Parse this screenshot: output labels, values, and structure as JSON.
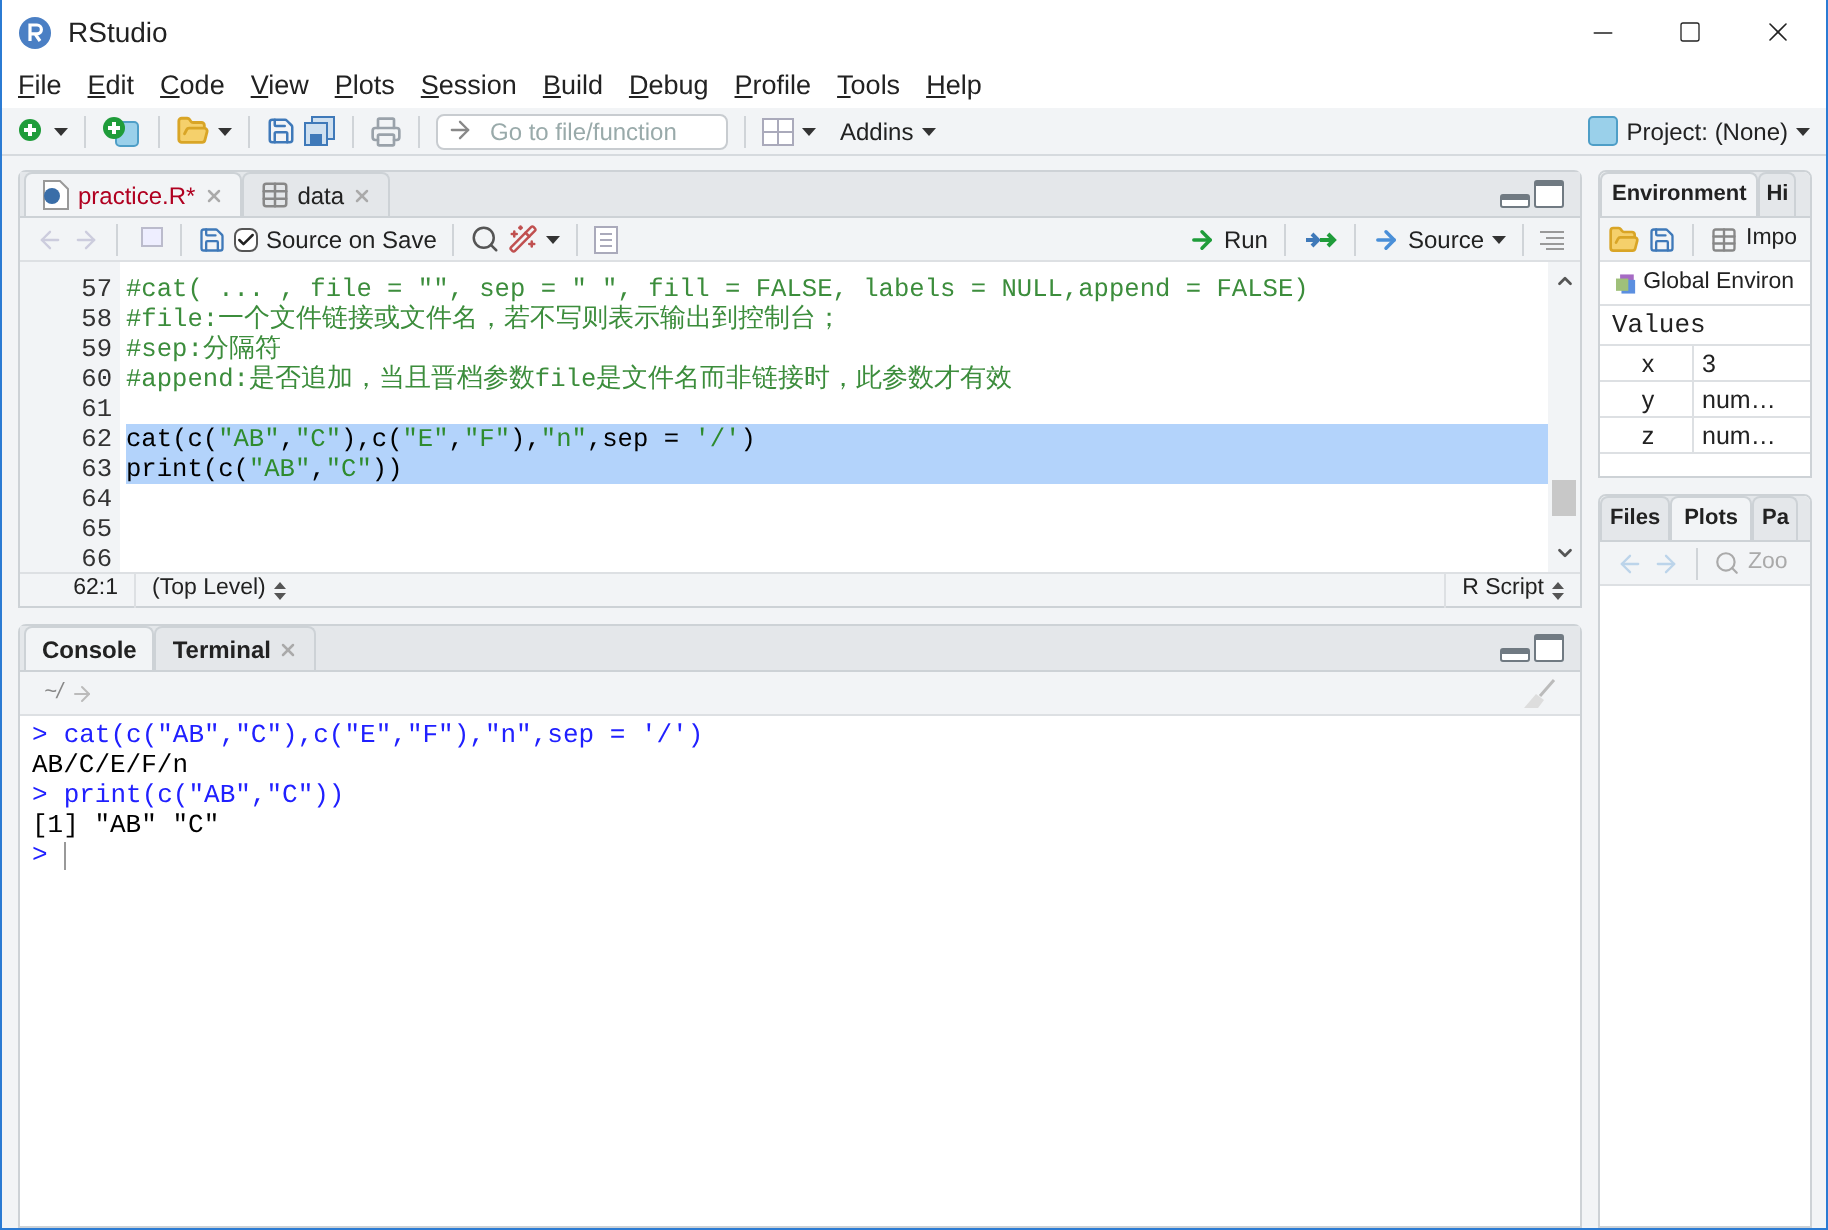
{
  "window": {
    "title": "RStudio"
  },
  "menu": [
    {
      "label": "File"
    },
    {
      "label": "Edit"
    },
    {
      "label": "Code"
    },
    {
      "label": "View"
    },
    {
      "label": "Plots"
    },
    {
      "label": "Session"
    },
    {
      "label": "Build"
    },
    {
      "label": "Debug"
    },
    {
      "label": "Profile"
    },
    {
      "label": "Tools"
    },
    {
      "label": "Help"
    }
  ],
  "toolbar": {
    "go_to_file": {
      "placeholder": "Go to file/function"
    },
    "addins": "Addins",
    "project": "Project: (None)"
  },
  "editor": {
    "tabs": [
      {
        "label": "practice.R*",
        "kind": "script",
        "selected": true,
        "modified": true
      },
      {
        "label": "data",
        "kind": "data",
        "selected": false,
        "modified": false
      }
    ],
    "source_on_save": {
      "label": "Source on Save",
      "checked": true
    },
    "run": "Run",
    "source": "Source",
    "lines": [
      {
        "number": "57",
        "selected": false,
        "tokens": [
          {
            "text": "#cat( ... , file = \"\", sep = \" \", fill = FALSE, labels = NULL,append = FALSE)",
            "kind": "comment"
          }
        ]
      },
      {
        "number": "58",
        "selected": false,
        "tokens": [
          {
            "text": "#file:一个文件链接或文件名，若不写则表示输出到控制台；",
            "kind": "comment"
          }
        ]
      },
      {
        "number": "59",
        "selected": false,
        "tokens": [
          {
            "text": "#sep:分隔符",
            "kind": "comment"
          }
        ]
      },
      {
        "number": "60",
        "selected": false,
        "tokens": [
          {
            "text": "#append:是否追加，当且晋档参数file是文件名而非链接时，此参数才有效",
            "kind": "comment"
          }
        ]
      },
      {
        "number": "61"
      },
      {
        "number": "62",
        "selected": true,
        "tokens": [
          {
            "text": "cat(c(",
            "kind": "plain"
          },
          {
            "text": "\"AB\"",
            "kind": "string"
          },
          {
            "text": ",",
            "kind": "plain"
          },
          {
            "text": "\"C\"",
            "kind": "string"
          },
          {
            "text": "),c(",
            "kind": "plain"
          },
          {
            "text": "\"E\"",
            "kind": "string"
          },
          {
            "text": ",",
            "kind": "plain"
          },
          {
            "text": "\"F\"",
            "kind": "string"
          },
          {
            "text": "),",
            "kind": "plain"
          },
          {
            "text": "\"n\"",
            "kind": "string"
          },
          {
            "text": ",sep = ",
            "kind": "plain"
          },
          {
            "text": "'/'",
            "kind": "string"
          },
          {
            "text": ")",
            "kind": "plain"
          }
        ]
      },
      {
        "number": "63",
        "selected": true,
        "tokens": [
          {
            "text": "print(c(",
            "kind": "plain"
          },
          {
            "text": "\"AB\"",
            "kind": "string"
          },
          {
            "text": ",",
            "kind": "plain"
          },
          {
            "text": "\"C\"",
            "kind": "string"
          },
          {
            "text": "))",
            "kind": "plain"
          }
        ]
      },
      {
        "number": "64"
      },
      {
        "number": "65"
      },
      {
        "number": "66"
      }
    ],
    "status": {
      "position": "62:1",
      "scope": "(Top Level)",
      "filetype": "R Script"
    }
  },
  "console": {
    "tabs": [
      {
        "label": "Console",
        "selected": true,
        "closable": false
      },
      {
        "label": "Terminal",
        "selected": false,
        "closable": true
      }
    ],
    "path": "~/",
    "lines": [
      {
        "kind": "input",
        "prompt": ">",
        "text": "cat(c(\"AB\",\"C\"),c(\"E\",\"F\"),\"n\",sep = '/')"
      },
      {
        "kind": "output",
        "text": "AB/C/E/F/n"
      },
      {
        "kind": "input",
        "prompt": ">",
        "text": "print(c(\"AB\",\"C\"))"
      },
      {
        "kind": "output",
        "text": "[1] \"AB\" \"C\""
      },
      {
        "kind": "prompt",
        "prompt": ">"
      }
    ]
  },
  "environment": {
    "tabs": [
      {
        "label": "Environment",
        "selected": true
      },
      {
        "label": "Hi",
        "selected": false
      }
    ],
    "import": "Impo",
    "scope": "Global Environ",
    "section": "Values",
    "rows": [
      {
        "name": "x",
        "value": "3"
      },
      {
        "name": "y",
        "value": "num…"
      },
      {
        "name": "z",
        "value": "num…"
      }
    ]
  },
  "files": {
    "tabs": [
      {
        "label": "Files",
        "selected": false
      },
      {
        "label": "Plots",
        "selected": true
      },
      {
        "label": "Pa",
        "selected": false
      }
    ],
    "zoom": "Zoo"
  }
}
